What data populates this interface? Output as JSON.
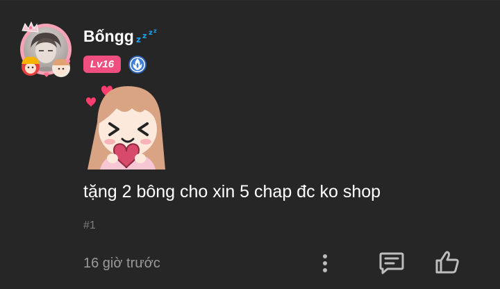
{
  "comment": {
    "username": "Bốngg",
    "level_label": "Lv16",
    "text": "tặng 2 bông cho xin 5 chap đc ko shop",
    "index_label": "#1",
    "time_label": "16 giờ trước"
  },
  "icons": {
    "status": "zzz-sleep-icon",
    "rank": "blue-flame-rank-icon",
    "more": "more-vertical-icon",
    "reply": "reply-message-icon",
    "like": "thumbs-up-icon"
  },
  "colors": {
    "background": "#262626",
    "level_badge": "#ee4f7e",
    "zzz": "#1da1f2",
    "rank_badge": "#3f7fd9",
    "muted_text": "#9a9a9a",
    "icon": "#bdbdbd"
  }
}
